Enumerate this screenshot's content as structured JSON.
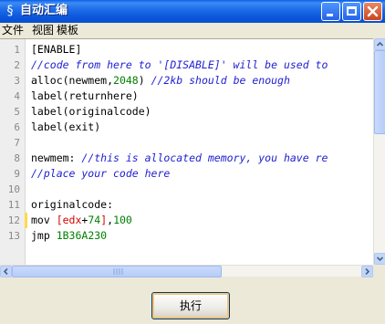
{
  "window": {
    "title": "自动汇编",
    "icon": "ce-app-icon"
  },
  "menu": [
    "文件",
    "视图",
    "模板"
  ],
  "editor": {
    "line_numbers": [
      "1",
      "2",
      "3",
      "4",
      "5",
      "6",
      "7",
      "8",
      "9",
      "10",
      "11",
      "12",
      "13"
    ],
    "lines": [
      [
        {
          "t": "[ENABLE]",
          "c": "plain"
        }
      ],
      [
        {
          "t": "//code from here to '[DISABLE]' will be used to",
          "c": "comment"
        }
      ],
      [
        {
          "t": "alloc(newmem,",
          "c": "plain"
        },
        {
          "t": "2048",
          "c": "num"
        },
        {
          "t": ") ",
          "c": "plain"
        },
        {
          "t": "//2kb should be enough",
          "c": "comment"
        }
      ],
      [
        {
          "t": "label(returnhere)",
          "c": "plain"
        }
      ],
      [
        {
          "t": "label(originalcode)",
          "c": "plain"
        }
      ],
      [
        {
          "t": "label(exit)",
          "c": "plain"
        }
      ],
      [],
      [
        {
          "t": "newmem: ",
          "c": "plain"
        },
        {
          "t": "//this is allocated memory, you have re",
          "c": "comment"
        }
      ],
      [
        {
          "t": "//place your code here",
          "c": "comment"
        }
      ],
      [],
      [
        {
          "t": "originalcode:",
          "c": "plain"
        }
      ],
      [
        {
          "t": "mov ",
          "c": "plain"
        },
        {
          "t": "[edx",
          "c": "reg"
        },
        {
          "t": "+",
          "c": "plain"
        },
        {
          "t": "74",
          "c": "num"
        },
        {
          "t": "]",
          "c": "reg"
        },
        {
          "t": ",",
          "c": "plain"
        },
        {
          "t": "100",
          "c": "num"
        }
      ],
      [
        {
          "t": "jmp ",
          "c": "plain"
        },
        {
          "t": "1B36A230",
          "c": "num"
        }
      ]
    ],
    "modified_line": "12"
  },
  "execute_button": "执行",
  "colors": {
    "titlebar": "#0a5fe6",
    "comment": "#1f1fd0",
    "number": "#008000",
    "register": "#d60000",
    "modified_marker": "#ffd84a"
  }
}
